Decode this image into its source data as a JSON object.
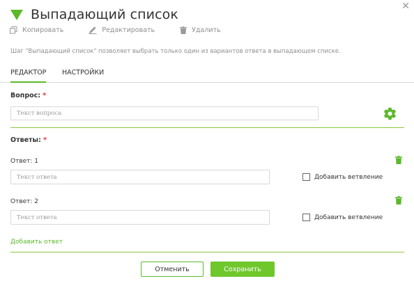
{
  "header": {
    "title": "Выпадающий список",
    "close_icon": "close-icon"
  },
  "toolbar": {
    "copy_label": "Копировать",
    "edit_label": "Редактировать",
    "delete_label": "Удалить"
  },
  "description": "Шаг \"Выпадающий список\" позволяет выбрать только один из вариантов ответа в выпадающем списке.",
  "tabs": [
    {
      "label": "РЕДАКТОР",
      "active": true
    },
    {
      "label": "НАСТРОЙКИ",
      "active": false
    }
  ],
  "question": {
    "label": "Вопрос:",
    "required_mark": "*",
    "placeholder": "Текст вопроса",
    "value": ""
  },
  "answers": {
    "label": "Ответы:",
    "required_mark": "*",
    "items": [
      {
        "label": "Ответ: 1",
        "placeholder": "Текст ответа",
        "value": "",
        "branch_label": "Добавить ветвление",
        "branch_checked": false
      },
      {
        "label": "Ответ: 2",
        "placeholder": "Текст ответа",
        "value": "",
        "branch_label": "Добавить ветвление",
        "branch_checked": false
      }
    ],
    "add_label": "Добавить ответ"
  },
  "footer": {
    "cancel_label": "Отменить",
    "save_label": "Сохранить"
  },
  "colors": {
    "accent": "#5cb82b",
    "save_button": "#6fc72c",
    "separator": "#8cc63f",
    "required": "#e53935"
  }
}
